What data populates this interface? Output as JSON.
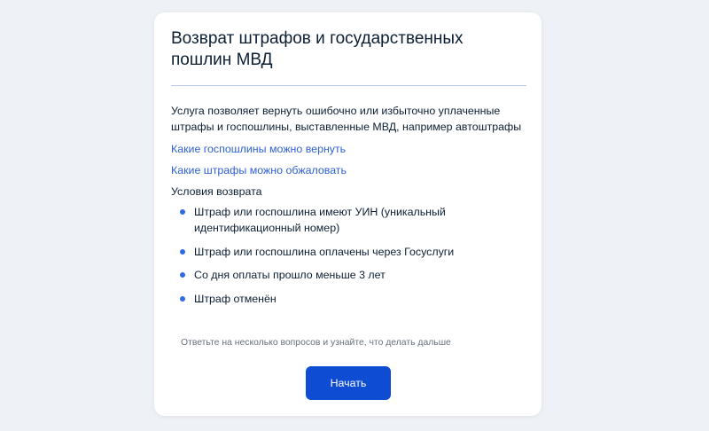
{
  "card": {
    "title": "Возврат штрафов и государственных пошлин МВД",
    "description": "Услуга позволяет вернуть ошибочно или избыточно уплаченные штрафы и госпошлины, выставленные МВД, например автоштрафы",
    "links": [
      {
        "label": "Какие госпошлины можно вернуть"
      },
      {
        "label": "Какие штрафы можно обжаловать"
      }
    ],
    "conditions": {
      "heading": "Условия возврата",
      "items": [
        "Штраф или госпошлина имеют УИН (уникальный идентификационный номер)",
        "Штраф или госпошлина оплачены через Госуслуги",
        "Со дня оплаты прошло меньше 3 лет",
        "Штраф отменён"
      ]
    },
    "hint": "Ответьте на несколько вопросов и узнайте, что делать дальше",
    "start_button_label": "Начать"
  },
  "colors": {
    "background": "#eef1f6",
    "card": "#ffffff",
    "text": "#0b1f33",
    "link": "#2e5fd6",
    "bullet": "#2e6be6",
    "button": "#0d4cd3",
    "hint": "#66727f",
    "divider": "#b8c8e6"
  }
}
